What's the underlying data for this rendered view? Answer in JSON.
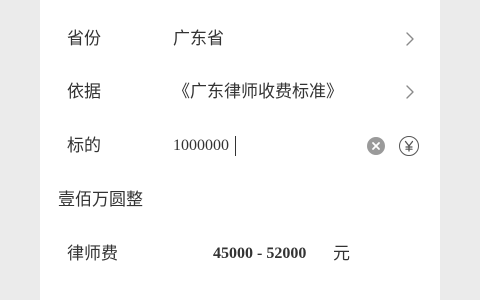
{
  "form": {
    "province": {
      "label": "省份",
      "value": "广东省",
      "icon": "chevron-right-icon"
    },
    "basis": {
      "label": "依据",
      "value": "《广东律师收费标准》",
      "icon": "chevron-right-icon"
    },
    "amount": {
      "label": "标的",
      "value": "1000000",
      "clear_icon": "clear-icon",
      "currency_icon": "yen-icon"
    },
    "amount_in_chinese": "壹佰万圆整"
  },
  "result": {
    "label": "律师费",
    "range": "45000 - 52000",
    "unit": "元"
  },
  "colors": {
    "background": "#ebebeb",
    "card": "#ffffff",
    "text": "#333333",
    "icon_gray": "#9a9a9a"
  }
}
